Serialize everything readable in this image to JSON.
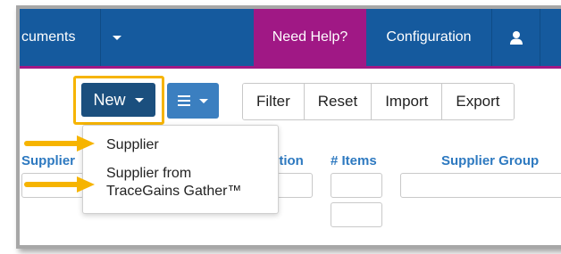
{
  "navbar": {
    "documents_label": "cuments",
    "help_label": "Need Help?",
    "config_label": "Configuration",
    "bg_color": "#155a9e",
    "help_color": "#a01885"
  },
  "toolbar": {
    "new_label": "New",
    "filter_label": "Filter",
    "reset_label": "Reset",
    "import_label": "Import",
    "export_label": "Export"
  },
  "new_menu": {
    "items": [
      {
        "line1": "Supplier",
        "line2": ""
      },
      {
        "line1": "Supplier from",
        "line2": "TraceGains Gather™"
      }
    ]
  },
  "columns": {
    "supplier": "Supplier",
    "section": "ction",
    "items": "# Items",
    "supplier_group": "Supplier Group"
  },
  "colors": {
    "highlight": "#f6b400",
    "link_blue": "#2d79c0"
  }
}
